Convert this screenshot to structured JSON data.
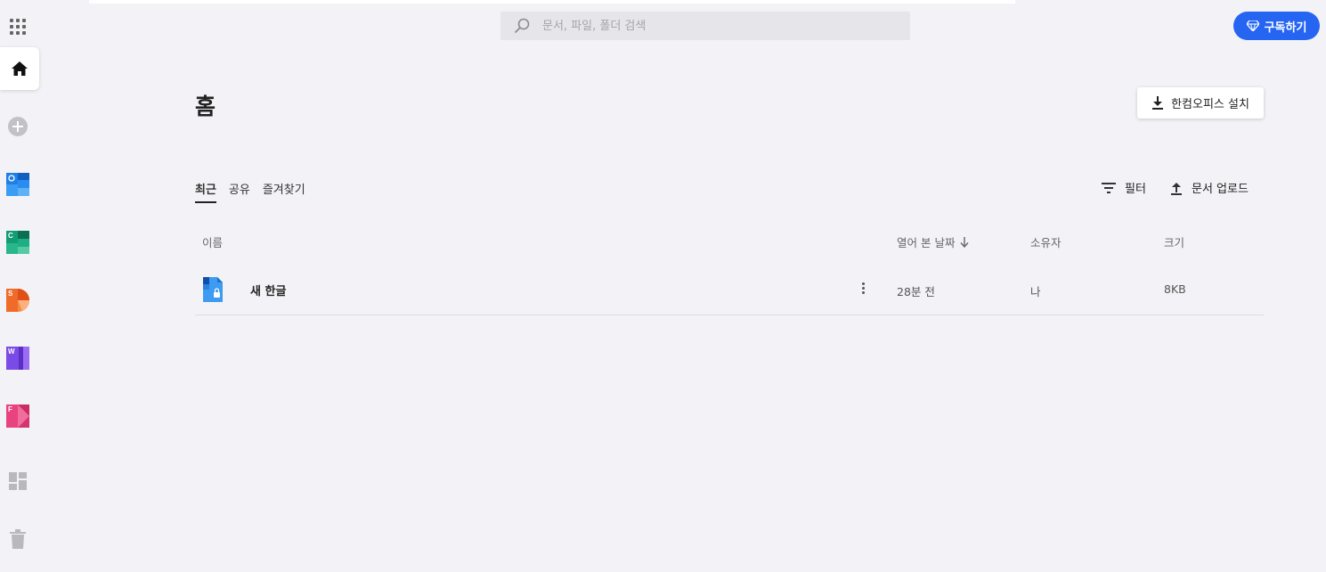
{
  "header": {
    "search_placeholder": "문서, 파일, 폴더 검색",
    "subscribe_label": "구독하기"
  },
  "sidebar": {
    "apps": [
      {
        "name": "calendar",
        "letter": ""
      },
      {
        "name": "calc",
        "letter": "C"
      },
      {
        "name": "show",
        "letter": "S"
      },
      {
        "name": "hwp",
        "letter": "W"
      },
      {
        "name": "forms",
        "letter": "F"
      }
    ]
  },
  "main": {
    "title": "홈",
    "install_label": "한컴오피스 설치",
    "tabs": [
      {
        "label": "최근",
        "active": true
      },
      {
        "label": "공유",
        "active": false
      },
      {
        "label": "즐겨찾기",
        "active": false
      }
    ],
    "filter_label": "필터",
    "upload_label": "문서 업로드",
    "columns": {
      "name": "이름",
      "opened": "열어 본 날짜",
      "owner": "소유자",
      "size": "크기"
    },
    "files": [
      {
        "name": "새 한글",
        "opened": "28분 전",
        "owner": "나",
        "size": "8KB"
      }
    ]
  },
  "colors": {
    "accent": "#2565f2",
    "background": "#f3f3f7"
  }
}
